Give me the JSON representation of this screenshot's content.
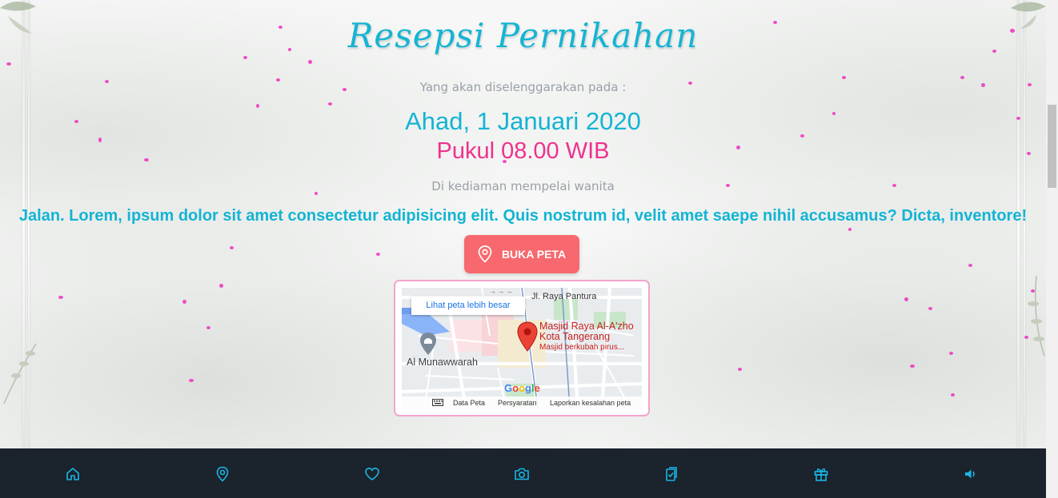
{
  "section": {
    "title": "Resepsi Pernikahan",
    "intro": "Yang akan diselenggarakan pada :",
    "date": "Ahad, 1 Januari 2020",
    "time": "Pukul 08.00 WIB",
    "location_note": "Di kediaman mempelai wanita",
    "address": "Jalan. Lorem, ipsum dolor sit amet consectetur adipisicing elit. Quis nostrum id, velit amet saepe nihil accusamus? Dicta, inventore!",
    "map_button_label": "BUKA PETA"
  },
  "map": {
    "view_larger_link": "Lihat peta lebih besar",
    "place_name_line1": "Masjid Raya Al-A'zho",
    "place_name_line2": "Kota Tangerang",
    "place_desc": "Masjid berkubah pirus...",
    "road_label": "Jl. Raya Pantura",
    "poi_label": "Al Munawwarah",
    "google_logo": "Google",
    "footer_data": "Data Peta",
    "footer_terms": "Persyaratan",
    "footer_report": "Laporkan kesalahan peta"
  },
  "bottom_nav": [
    {
      "icon": "home-icon"
    },
    {
      "icon": "location-pin-icon"
    },
    {
      "icon": "heart-icon"
    },
    {
      "icon": "camera-icon"
    },
    {
      "icon": "clipboard-check-icon"
    },
    {
      "icon": "gift-icon"
    },
    {
      "icon": "volume-icon"
    }
  ],
  "colors": {
    "accent_cyan": "#13b4d4",
    "accent_pink": "#f0318e",
    "button_coral": "#f7696e",
    "nav_background": "#1b232c"
  }
}
